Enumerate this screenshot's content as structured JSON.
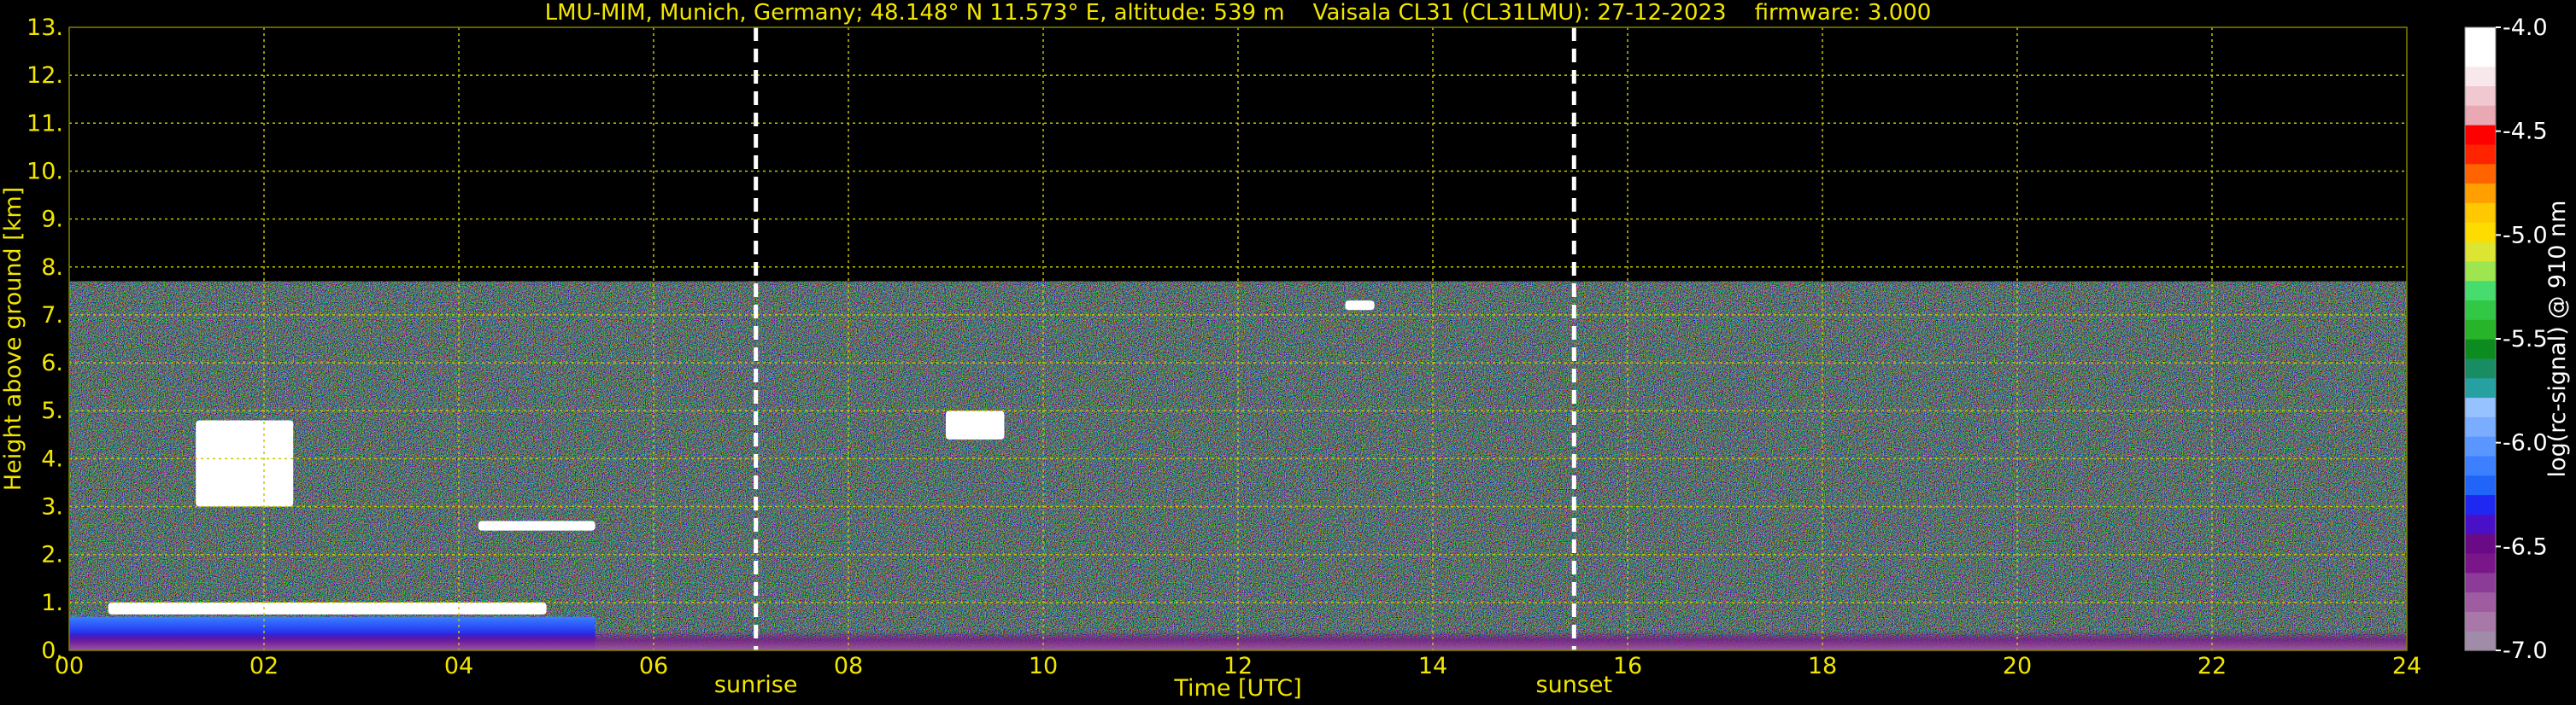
{
  "chart_data": {
    "type": "heatmap",
    "title": "LMU-MIM, Munich, Germany; 48.148° N 11.573° E, altitude: 539 m    Vaisala CL31 (CL31LMU): 27-12-2023    firmware: 3.000",
    "xlabel": "Time [UTC]",
    "ylabel": "Height above ground [km]",
    "xlim": [
      0,
      24
    ],
    "ylim": [
      0,
      13
    ],
    "x_ticks": [
      "00",
      "02",
      "04",
      "06",
      "08",
      "10",
      "12",
      "14",
      "16",
      "18",
      "20",
      "22",
      "24"
    ],
    "y_ticks": [
      "0.",
      "1.",
      "2.",
      "3.",
      "4.",
      "5.",
      "6.",
      "7.",
      "8.",
      "9.",
      "10.",
      "11.",
      "12.",
      "13."
    ],
    "grid": true,
    "measurement_top_km": 7.7,
    "events": [
      {
        "label": "sunrise",
        "time_utc": 7.05
      },
      {
        "label": "sunset",
        "time_utc": 15.45
      }
    ],
    "features": [
      {
        "kind": "boundary-layer aerosol (blue)",
        "t0": 0,
        "t1": 5.4,
        "h0": 0,
        "h1": 0.7
      },
      {
        "kind": "low cloud base (white)",
        "t0": 0.4,
        "t1": 4.9,
        "h0": 0.75,
        "h1": 1.0
      },
      {
        "kind": "near-surface aerosol (magenta)",
        "t0": 0,
        "t1": 24,
        "h0": 0,
        "h1": 0.4
      },
      {
        "kind": "cloud (white)",
        "t0": 1.3,
        "t1": 2.3,
        "h0": 3.0,
        "h1": 4.8
      },
      {
        "kind": "thin cloud (white)",
        "t0": 4.2,
        "t1": 5.4,
        "h0": 2.5,
        "h1": 2.7
      },
      {
        "kind": "cloud (white)",
        "t0": 9.0,
        "t1": 9.6,
        "h0": 4.4,
        "h1": 5.0
      },
      {
        "kind": "cloud (white)",
        "t0": 13.1,
        "t1": 13.4,
        "h0": 7.1,
        "h1": 7.3
      }
    ],
    "colorbar": {
      "label": "log(rc-signal) @ 910 nm",
      "min": -7.0,
      "max": -4.0,
      "ticks": [
        "-4.0",
        "-4.5",
        "-5.0",
        "-5.5",
        "-6.0",
        "-6.5",
        "-7.0"
      ],
      "colors": [
        "#a08ca8",
        "#a878a8",
        "#a05ca0",
        "#8c3c98",
        "#7a168a",
        "#6a0a86",
        "#4a10c8",
        "#1e28f0",
        "#2064f8",
        "#3c80ff",
        "#5a96ff",
        "#7aacff",
        "#96c2ff",
        "#26a0a0",
        "#1a8c64",
        "#0c8c1e",
        "#28b428",
        "#32c846",
        "#46dc6e",
        "#9ee650",
        "#dce632",
        "#ffdc00",
        "#ffc800",
        "#ffa000",
        "#ff6400",
        "#ff2400",
        "#ff0000",
        "#e8a8b4",
        "#f0c8d0",
        "#f8e8ec",
        "#ffffff",
        "#ffffff"
      ]
    }
  }
}
